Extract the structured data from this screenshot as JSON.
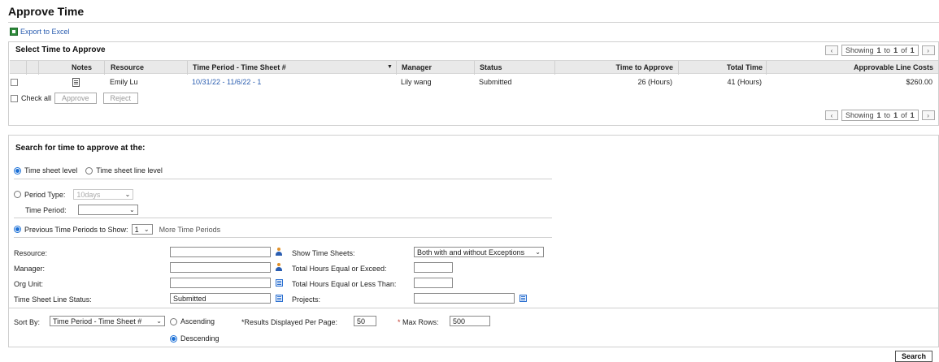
{
  "page": {
    "title": "Approve Time",
    "export_label": "Export to Excel"
  },
  "approve": {
    "title": "Select Time to Approve",
    "pager": {
      "prefix": "Showing",
      "from": "1",
      "to_word": "to",
      "to": "1",
      "of_word": "of",
      "total": "1"
    },
    "columns": [
      "Notes",
      "Resource",
      "Time Period - Time Sheet #",
      "Manager",
      "Status",
      "Time to Approve",
      "Total Time",
      "Approvable Line Costs"
    ],
    "sort_indicator": "▼",
    "rows": [
      {
        "resource": "Emily Lu",
        "period": "10/31/22 - 11/6/22 - 1",
        "manager": "Lily wang",
        "status": "Submitted",
        "time_to_approve": "26 (Hours)",
        "total_time": "41 (Hours)",
        "line_costs": "$260.00"
      }
    ],
    "check_all": "Check all",
    "approve_btn": "Approve",
    "reject_btn": "Reject"
  },
  "search": {
    "title": "Search for time to approve at the:",
    "level_options": [
      "Time sheet level",
      "Time sheet line level"
    ],
    "period_type_label": "Period Type:",
    "period_type_value": "10days",
    "time_period_label": "Time Period:",
    "time_period_value": "",
    "prev_periods_label": "Previous Time Periods to Show:",
    "prev_periods_value": "1",
    "more_periods": "More Time Periods",
    "resource_label": "Resource:",
    "manager_label": "Manager:",
    "org_unit_label": "Org Unit:",
    "line_status_label": "Time Sheet Line Status:",
    "line_status_value": "Submitted",
    "show_sheets_label": "Show Time Sheets:",
    "show_sheets_value": "Both with and without Exceptions",
    "hours_exceed_label": "Total Hours Equal or Exceed:",
    "hours_less_label": "Total Hours Equal or Less Than:",
    "projects_label": "Projects:",
    "sort_by_label": "Sort By:",
    "sort_by_value": "Time Period - Time Sheet #",
    "ascending": "Ascending",
    "descending": "Descending",
    "results_per_page_label": "*Results Displayed Per Page:",
    "results_per_page_value": "50",
    "max_rows_label": "Max Rows:",
    "max_rows_value": "500",
    "required_mark": "*",
    "search_btn": "Search"
  }
}
